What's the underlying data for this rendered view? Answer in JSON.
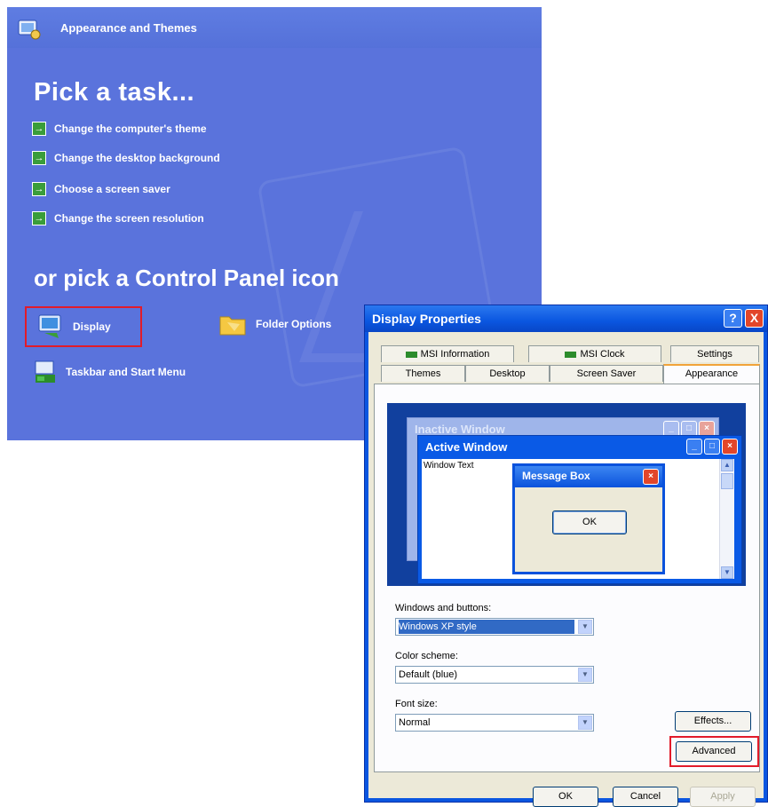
{
  "control_panel": {
    "header_title": "Appearance and Themes",
    "pick_task_title": "Pick a task...",
    "tasks": [
      "Change the computer's theme",
      "Change the desktop background",
      "Choose a screen saver",
      "Change the screen resolution"
    ],
    "or_pick_title": "or pick a Control Panel icon",
    "icons": {
      "display": "Display",
      "folder_options": "Folder Options",
      "taskbar": "Taskbar and Start Menu"
    }
  },
  "dialog": {
    "title": "Display Properties",
    "help_glyph": "?",
    "close_glyph": "X",
    "tabs_row1": [
      "MSI Information",
      "MSI Clock",
      "Settings"
    ],
    "tabs_row2": [
      "Themes",
      "Desktop",
      "Screen Saver",
      "Appearance"
    ],
    "preview": {
      "inactive_window": "Inactive Window",
      "active_window": "Active Window",
      "window_text": "Window Text",
      "message_box": "Message Box",
      "message_ok": "OK"
    },
    "windows_buttons_label": "Windows and buttons:",
    "windows_buttons_value": "Windows XP style",
    "color_scheme_label": "Color scheme:",
    "color_scheme_value": "Default (blue)",
    "font_size_label": "Font size:",
    "font_size_value": "Normal",
    "effects_button": "Effects...",
    "advanced_button": "Advanced",
    "ok_button": "OK",
    "cancel_button": "Cancel",
    "apply_button": "Apply"
  },
  "colors": {
    "panel_blue": "#5a73dc",
    "dialog_blue": "#0a56e0",
    "highlight_red": "#e21b2a",
    "dialog_face": "#ece9d8"
  }
}
